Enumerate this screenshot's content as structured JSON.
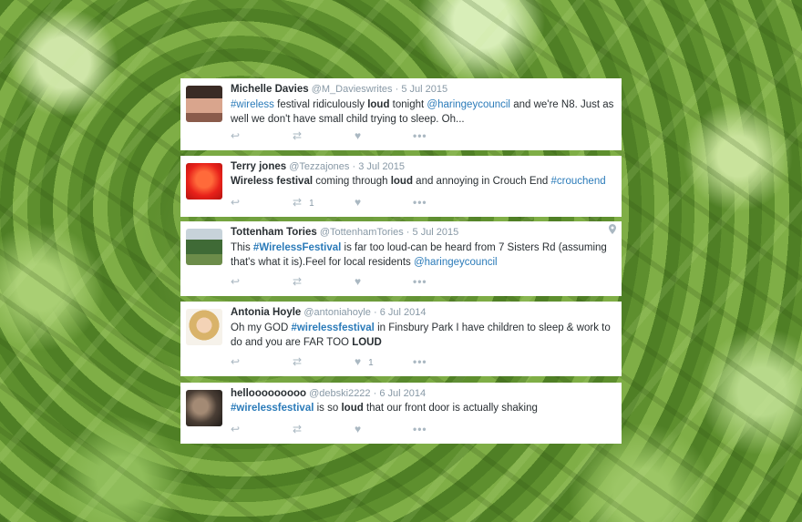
{
  "tweets": [
    {
      "name": "Michelle Davies",
      "handle": "@M_Davieswrites",
      "date": "5 Jul 2015",
      "parts": [
        {
          "t": "#wireless",
          "c": "link"
        },
        {
          "t": " festival ridiculously "
        },
        {
          "t": "loud",
          "c": "b"
        },
        {
          "t": " tonight "
        },
        {
          "t": "@haringeycouncil",
          "c": "link"
        },
        {
          "t": " and we're N8. Just as well we don't have small child trying to sleep. Oh..."
        }
      ],
      "rt_count": "",
      "like_count": ""
    },
    {
      "name": "Terry jones",
      "handle": "@Tezzajones",
      "date": "3 Jul 2015",
      "parts": [
        {
          "t": "Wireless festival",
          "c": "b"
        },
        {
          "t": " coming through "
        },
        {
          "t": "loud",
          "c": "b"
        },
        {
          "t": " and annoying in Crouch End "
        },
        {
          "t": "#crouchend",
          "c": "link"
        }
      ],
      "rt_count": "1",
      "like_count": ""
    },
    {
      "name": "Tottenham Tories",
      "handle": "@TottenhamTories",
      "date": "5 Jul 2015",
      "parts": [
        {
          "t": "This "
        },
        {
          "t": "#WirelessFestival",
          "c": "link b"
        },
        {
          "t": " is far too loud-can be heard from 7 Sisters Rd (assuming that's what it is).Feel for local residents "
        },
        {
          "t": "@haringeycouncil",
          "c": "link"
        }
      ],
      "rt_count": "",
      "like_count": ""
    },
    {
      "name": "Antonia Hoyle",
      "handle": "@antoniahoyle",
      "date": "6 Jul 2014",
      "parts": [
        {
          "t": "Oh my GOD "
        },
        {
          "t": "#wirelessfestival",
          "c": "link b"
        },
        {
          "t": " in Finsbury Park I have children to sleep & work to do and you are FAR TOO "
        },
        {
          "t": "LOUD",
          "c": "b"
        }
      ],
      "rt_count": "",
      "like_count": "1"
    },
    {
      "name": "hellooooooooo",
      "handle": "@debski2222",
      "date": "6 Jul 2014",
      "parts": [
        {
          "t": "#wirelessfestival",
          "c": "link b"
        },
        {
          "t": " is so "
        },
        {
          "t": "loud",
          "c": "b"
        },
        {
          "t": " that our front door is actually shaking"
        }
      ],
      "rt_count": "",
      "like_count": ""
    }
  ],
  "icons": {
    "reply": "reply-icon",
    "retweet": "retweet-icon",
    "like": "heart-icon",
    "more": "more-icon",
    "location": "location-pin-icon"
  },
  "colors": {
    "link": "#2b7bb9",
    "muted": "#8899a6",
    "text": "#292f33",
    "icon": "#aab8c2"
  }
}
